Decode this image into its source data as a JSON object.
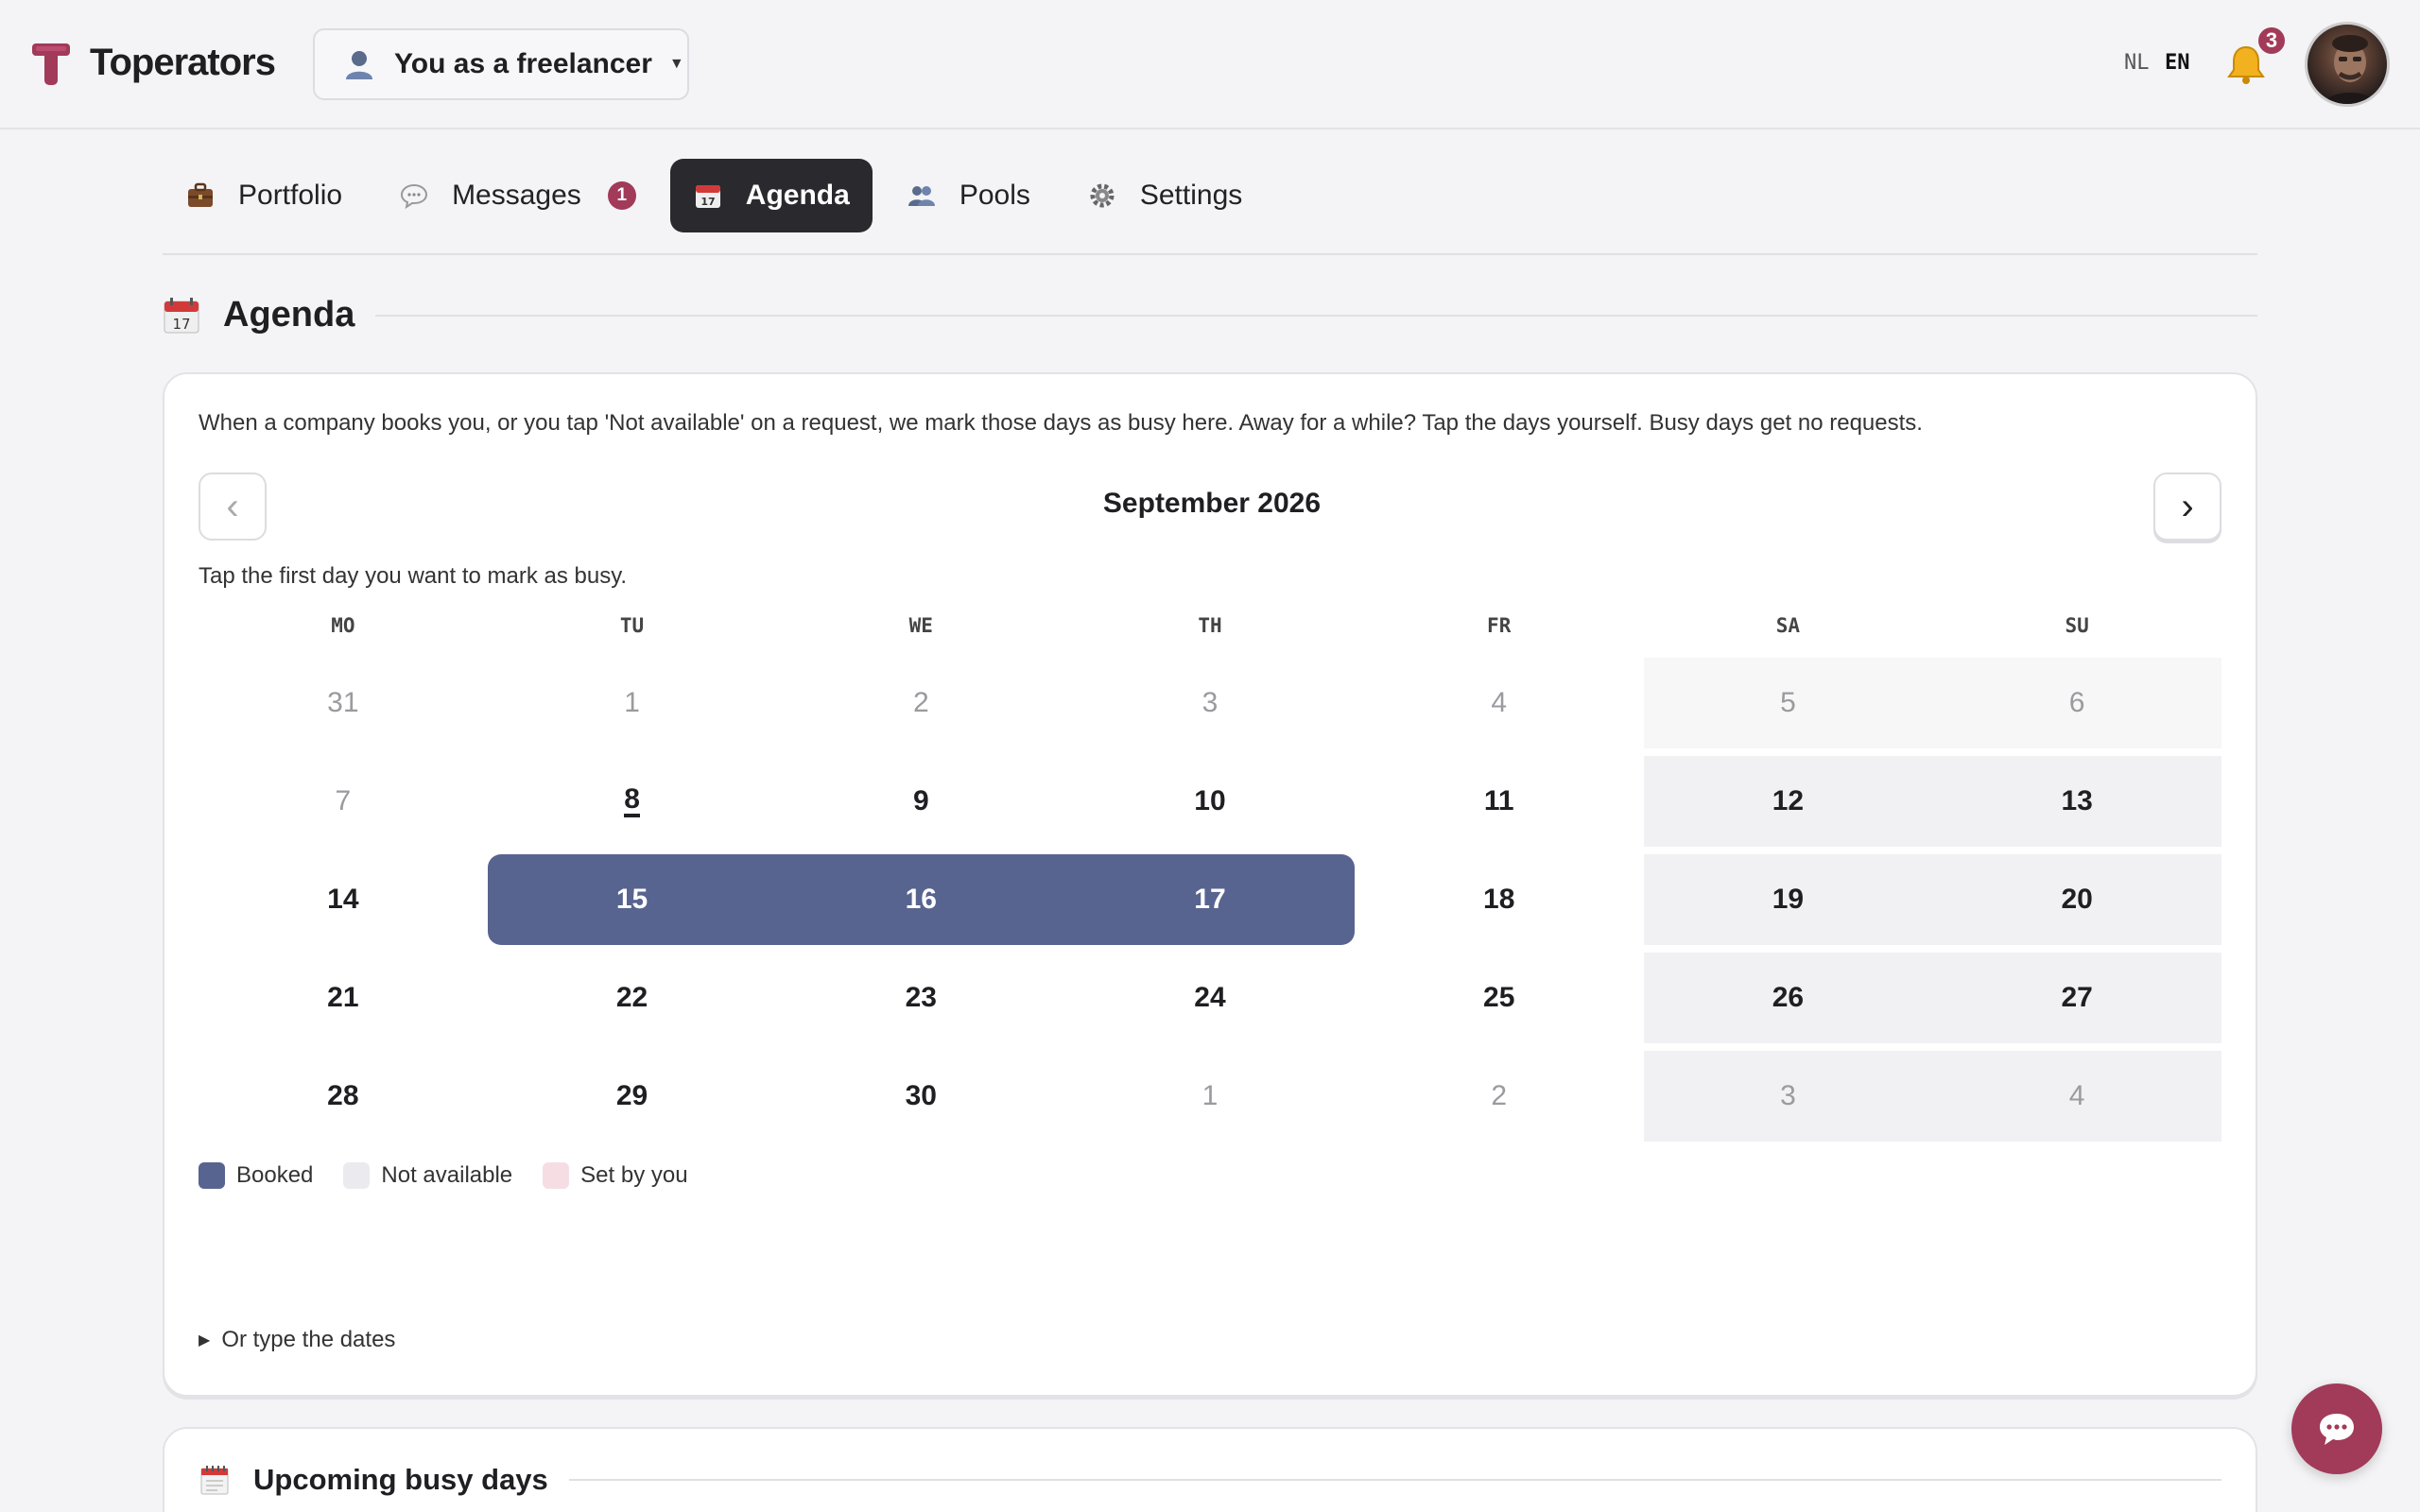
{
  "header": {
    "brand": "Toperators",
    "role_label": "You as a freelancer",
    "lang_nl": "NL",
    "lang_en": "EN",
    "notifications_count": "3"
  },
  "tabs": [
    {
      "label": "Portfolio",
      "icon": "briefcase-icon"
    },
    {
      "label": "Messages",
      "icon": "speech-bubble-icon",
      "badge": "1"
    },
    {
      "label": "Agenda",
      "icon": "calendar-icon",
      "active": true
    },
    {
      "label": "Pools",
      "icon": "people-icon"
    },
    {
      "label": "Settings",
      "icon": "gear-icon"
    }
  ],
  "section": {
    "title": "Agenda",
    "calendar_icon_day": "17"
  },
  "agenda": {
    "intro": "When a company books you, or you tap 'Not available' on a request, we mark those days as busy here. Away for a while? Tap the days yourself. Busy days get no requests.",
    "prev_label": "‹",
    "next_label": "›",
    "month": "September 2026",
    "hint": "Tap the first day you want to mark as busy.",
    "weekdays": [
      "MO",
      "TU",
      "WE",
      "TH",
      "FR",
      "SA",
      "SU"
    ],
    "weeks": [
      [
        "31",
        "1",
        "2",
        "3",
        "4",
        "5",
        "6"
      ],
      [
        "7",
        "8",
        "9",
        "10",
        "11",
        "12",
        "13"
      ],
      [
        "14",
        "15",
        "16",
        "17",
        "18",
        "19",
        "20"
      ],
      [
        "21",
        "22",
        "23",
        "24",
        "25",
        "26",
        "27"
      ],
      [
        "28",
        "29",
        "30",
        "1",
        "2",
        "3",
        "4"
      ]
    ],
    "legend": {
      "booked": "Booked",
      "not_available": "Not available",
      "set_by_you": "Set by you"
    },
    "type_dates": "Or type the dates"
  },
  "upcoming": {
    "title": "Upcoming busy days"
  },
  "colors": {
    "accent": "#a23a59",
    "booked": "#586490",
    "not_available": "#ebebef",
    "set_by_you": "#f6dde4",
    "active_tab": "#2a2a2e"
  }
}
